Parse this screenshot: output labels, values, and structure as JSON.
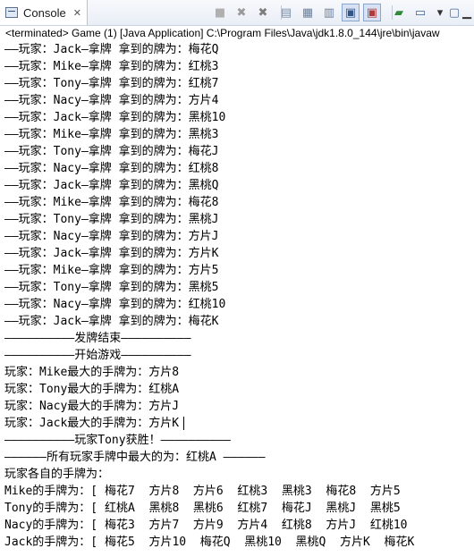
{
  "tab": {
    "label": "Console",
    "close": "✕"
  },
  "toolbar": {
    "buttons": [
      {
        "name": "terminate-icon",
        "glyph": "■",
        "color": "#b0b0b0"
      },
      {
        "name": "remove-launch-icon",
        "glyph": "✖",
        "color": "#9a9a9a"
      },
      {
        "name": "remove-all-terminated-icon",
        "glyph": "✖",
        "color": "#7d7d7d"
      },
      {
        "name": "clear-console-icon",
        "glyph": "▤",
        "color": "#7a8ea8"
      },
      {
        "name": "scroll-lock-icon",
        "glyph": "▦",
        "color": "#6b7f9c"
      },
      {
        "name": "word-wrap-icon",
        "glyph": "▥",
        "color": "#6b7f9c"
      },
      {
        "name": "show-console-on-output-icon",
        "glyph": "▣",
        "color": "#33558a"
      },
      {
        "name": "show-console-on-error-icon",
        "glyph": "▣",
        "color": "#b03a3a"
      },
      {
        "name": "pin-console-icon",
        "glyph": "▰",
        "color": "#2f8a3a"
      },
      {
        "name": "display-selected-console-icon",
        "glyph": "▭",
        "color": "#3b5f95"
      },
      {
        "name": "display-console-dropdown-icon",
        "glyph": "▾",
        "color": "#333333"
      },
      {
        "name": "open-console-icon",
        "glyph": "▢",
        "color": "#4a6b99"
      },
      {
        "name": "minimize-icon",
        "glyph": "▁",
        "color": "#333333"
      }
    ]
  },
  "status_line": "<terminated> Game (1) [Java Application] C:\\Program Files\\Java\\jdk1.8.0_144\\jre\\bin\\javaw",
  "lines": [
    "——玩家：Jack—拿牌 拿到的牌为：梅花Q",
    "——玩家：Mike—拿牌 拿到的牌为：红桃3",
    "——玩家：Tony—拿牌 拿到的牌为：红桃7",
    "——玩家：Nacy—拿牌 拿到的牌为：方片4",
    "——玩家：Jack—拿牌 拿到的牌为：黑桃10",
    "——玩家：Mike—拿牌 拿到的牌为：黑桃3",
    "——玩家：Tony—拿牌 拿到的牌为：梅花J",
    "——玩家：Nacy—拿牌 拿到的牌为：红桃8",
    "——玩家：Jack—拿牌 拿到的牌为：黑桃Q",
    "——玩家：Mike—拿牌 拿到的牌为：梅花8",
    "——玩家：Tony—拿牌 拿到的牌为：黑桃J",
    "——玩家：Nacy—拿牌 拿到的牌为：方片J",
    "——玩家：Jack—拿牌 拿到的牌为：方片K",
    "——玩家：Mike—拿牌 拿到的牌为：方片5",
    "——玩家：Tony—拿牌 拿到的牌为：黑桃5",
    "——玩家：Nacy—拿牌 拿到的牌为：红桃10",
    "——玩家：Jack—拿牌 拿到的牌为：梅花K",
    "——————————发牌结束——————————",
    "——————————开始游戏——————————",
    "玩家：Mike最大的手牌为：方片8",
    "玩家：Tony最大的手牌为：红桃A",
    "玩家：Nacy最大的手牌为：方片J",
    "玩家：Jack最大的手牌为：方片K",
    "——————————玩家Tony获胜！——————————",
    "——————所有玩家手牌中最大的为：红桃A ——————",
    "玩家各自的手牌为：",
    "Mike的手牌为：[ 梅花7  方片8  方片6  红桃3  黑桃3  梅花8  方片5",
    "Tony的手牌为：[ 红桃A  黑桃8  黑桃6  红桃7  梅花J  黑桃J  黑桃5",
    "Nacy的手牌为：[ 梅花3  方片7  方片9  方片4  红桃8  方片J  红桃10",
    "Jack的手牌为：[ 梅花5  方片10  梅花Q  黑桃10  黑桃Q  方片K  梅花K"
  ]
}
